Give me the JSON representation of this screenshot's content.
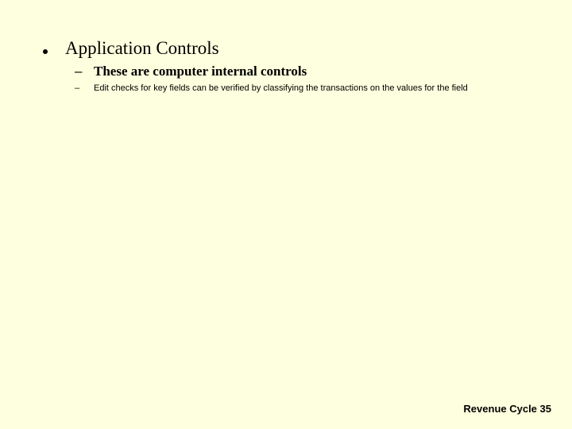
{
  "slide": {
    "level1": "Application Controls",
    "level2": "These are computer internal controls",
    "level3": "Edit checks for key fields can be verified by classifying the transactions on the values for the field"
  },
  "footer": {
    "text": "Revenue Cycle 35"
  }
}
